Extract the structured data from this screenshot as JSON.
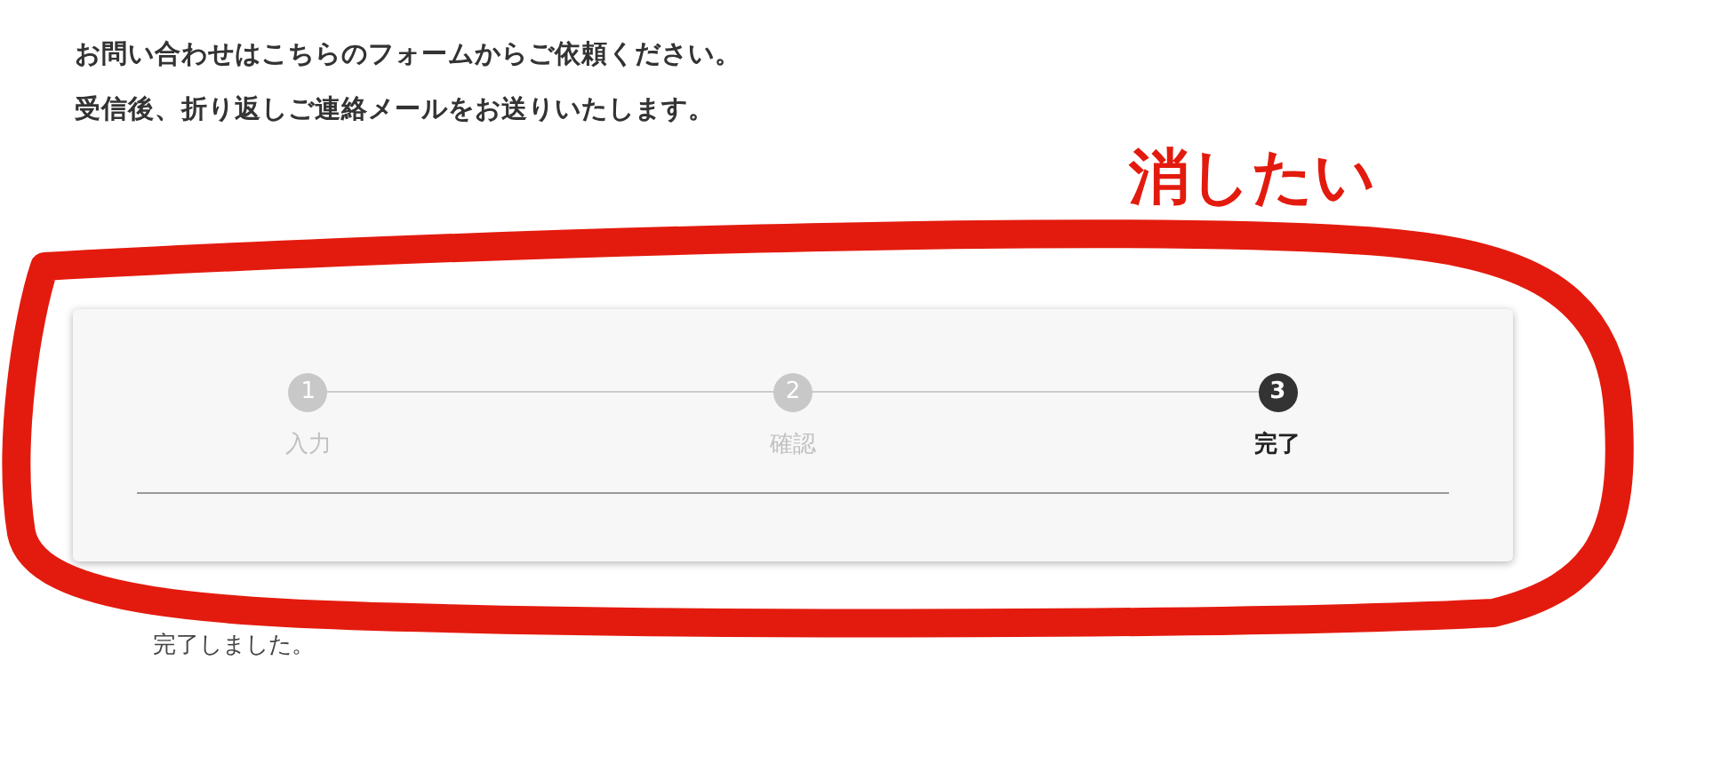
{
  "intro": [
    "お問い合わせはこちらのフォームからご依頼ください。",
    "受信後、折り返しご連絡メールをお送りいたします。"
  ],
  "annotation": {
    "text": "消したい"
  },
  "steps": [
    {
      "number": "1",
      "label": "入力",
      "selected": false
    },
    {
      "number": "2",
      "label": "確認",
      "selected": false
    },
    {
      "number": "3",
      "label": "完了",
      "selected": true
    }
  ],
  "message": "完了しました。"
}
